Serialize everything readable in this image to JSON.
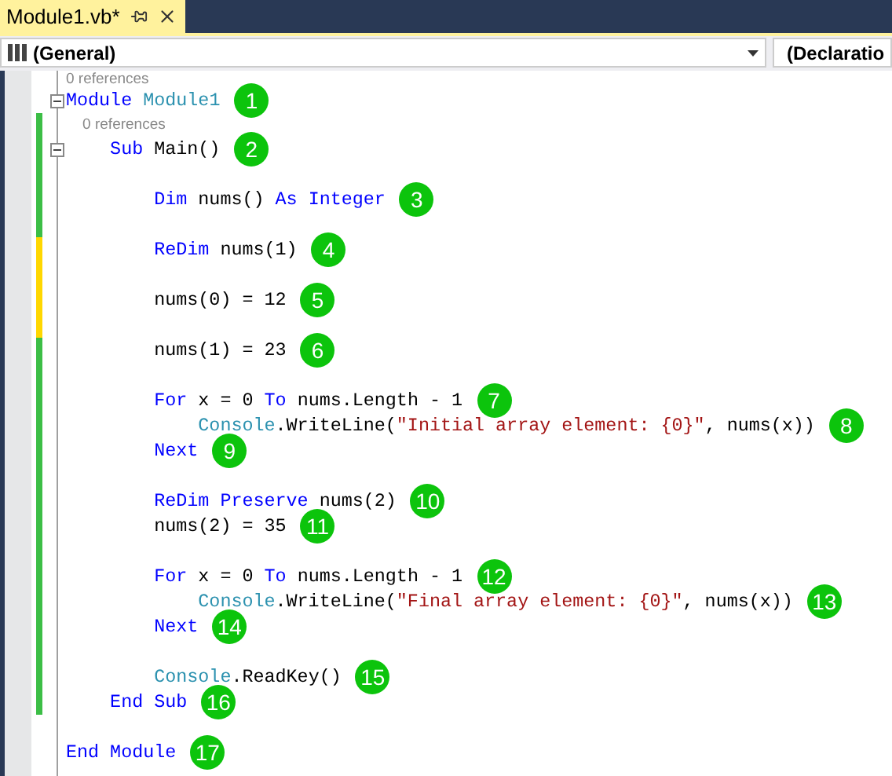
{
  "tab": {
    "title": "Module1.vb*",
    "selected": true
  },
  "toolbar": {
    "dropdowns": [
      {
        "label": "(General)"
      },
      {
        "label": "(Declaratio"
      }
    ]
  },
  "lines": [
    {
      "kind": "codelens",
      "text": "0 references"
    },
    {
      "kind": "code",
      "expanded": true,
      "tokens": [
        {
          "kind": "keyword",
          "s": "Module "
        },
        {
          "kind": "type",
          "s": "Module1"
        }
      ],
      "marker": "1"
    },
    {
      "kind": "codelens",
      "text": "    0 references",
      "modified": true,
      "saved": true
    },
    {
      "kind": "code",
      "expanded": true,
      "modified": true,
      "saved": true,
      "tokens": [
        {
          "kind": "keyword",
          "s": "    Sub "
        },
        {
          "kind": "plain",
          "s": "Main()"
        }
      ],
      "marker": "2"
    },
    {
      "kind": "blank",
      "modified": true,
      "saved": true
    },
    {
      "kind": "code",
      "modified": true,
      "saved": true,
      "tokens": [
        {
          "kind": "keyword",
          "s": "        Dim "
        },
        {
          "kind": "plain",
          "s": "nums() "
        },
        {
          "kind": "keyword",
          "s": "As Integer"
        }
      ],
      "marker": "3"
    },
    {
      "kind": "blank",
      "modified": true,
      "saved": true
    },
    {
      "kind": "code",
      "modified": true,
      "saved": false,
      "tokens": [
        {
          "kind": "keyword",
          "s": "        ReDim "
        },
        {
          "kind": "plain",
          "s": "nums(1)"
        }
      ],
      "marker": "4"
    },
    {
      "kind": "blank",
      "modified": true,
      "saved": false
    },
    {
      "kind": "code",
      "modified": true,
      "saved": false,
      "tokens": [
        {
          "kind": "plain",
          "s": "        nums(0) = 12"
        }
      ],
      "marker": "5"
    },
    {
      "kind": "blank",
      "modified": true,
      "saved": false
    },
    {
      "kind": "code",
      "modified": true,
      "saved": true,
      "tokens": [
        {
          "kind": "plain",
          "s": "        nums(1) = 23"
        }
      ],
      "marker": "6"
    },
    {
      "kind": "blank",
      "modified": true,
      "saved": true
    },
    {
      "kind": "code",
      "modified": true,
      "saved": true,
      "tokens": [
        {
          "kind": "keyword",
          "s": "        For "
        },
        {
          "kind": "plain",
          "s": "x = 0 "
        },
        {
          "kind": "keyword",
          "s": "To "
        },
        {
          "kind": "plain",
          "s": "nums.Length - 1"
        }
      ],
      "marker": "7"
    },
    {
      "kind": "code",
      "modified": true,
      "saved": true,
      "tokens": [
        {
          "kind": "type",
          "s": "            Console"
        },
        {
          "kind": "plain",
          "s": ".WriteLine("
        },
        {
          "kind": "string",
          "s": "\"Initial array element: {0}\""
        },
        {
          "kind": "plain",
          "s": ", nums(x))"
        }
      ],
      "marker": "8"
    },
    {
      "kind": "code",
      "modified": true,
      "saved": true,
      "tokens": [
        {
          "kind": "keyword",
          "s": "        Next"
        }
      ],
      "marker": "9"
    },
    {
      "kind": "blank",
      "modified": true,
      "saved": true
    },
    {
      "kind": "code",
      "modified": true,
      "saved": true,
      "tokens": [
        {
          "kind": "keyword",
          "s": "        ReDim Preserve "
        },
        {
          "kind": "plain",
          "s": "nums(2)"
        }
      ],
      "marker": "10"
    },
    {
      "kind": "code",
      "modified": true,
      "saved": true,
      "tokens": [
        {
          "kind": "plain",
          "s": "        nums(2) = 35"
        }
      ],
      "marker": "11"
    },
    {
      "kind": "blank",
      "modified": true,
      "saved": true
    },
    {
      "kind": "code",
      "modified": true,
      "saved": true,
      "tokens": [
        {
          "kind": "keyword",
          "s": "        For "
        },
        {
          "kind": "plain",
          "s": "x = 0 "
        },
        {
          "kind": "keyword",
          "s": "To "
        },
        {
          "kind": "plain",
          "s": "nums.Length - 1"
        }
      ],
      "marker": "12"
    },
    {
      "kind": "code",
      "modified": true,
      "saved": true,
      "tokens": [
        {
          "kind": "type",
          "s": "            Console"
        },
        {
          "kind": "plain",
          "s": ".WriteLine("
        },
        {
          "kind": "string",
          "s": "\"Final array element: {0}\""
        },
        {
          "kind": "plain",
          "s": ", nums(x))"
        }
      ],
      "marker": "13"
    },
    {
      "kind": "code",
      "modified": true,
      "saved": true,
      "tokens": [
        {
          "kind": "keyword",
          "s": "        Next"
        }
      ],
      "marker": "14"
    },
    {
      "kind": "blank",
      "modified": true,
      "saved": true
    },
    {
      "kind": "code",
      "modified": true,
      "saved": true,
      "tokens": [
        {
          "kind": "type",
          "s": "        Console"
        },
        {
          "kind": "plain",
          "s": ".ReadKey()"
        }
      ],
      "marker": "15"
    },
    {
      "kind": "code",
      "modified": true,
      "saved": true,
      "tokens": [
        {
          "kind": "keyword",
          "s": "    End Sub"
        }
      ],
      "marker": "16"
    },
    {
      "kind": "blank"
    },
    {
      "kind": "code",
      "tokens": [
        {
          "kind": "keyword",
          "s": "End Module"
        }
      ],
      "marker": "17"
    }
  ]
}
